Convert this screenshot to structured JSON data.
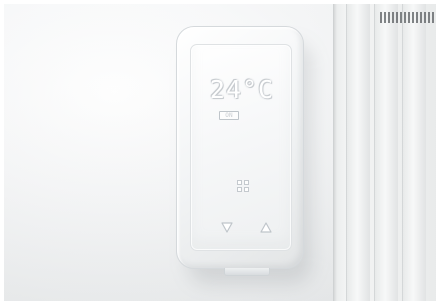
{
  "device": {
    "temperature": "24°C",
    "status": "ON"
  },
  "icons": {
    "menu": "grid-icon",
    "decrease": "triangle-down-icon",
    "increase": "triangle-up-icon"
  },
  "colors": {
    "wall": "#eef0f1",
    "device_body": "#f4f5f6",
    "display_outline": "#c8ccd0",
    "control_outline": "#c4c9ce"
  }
}
